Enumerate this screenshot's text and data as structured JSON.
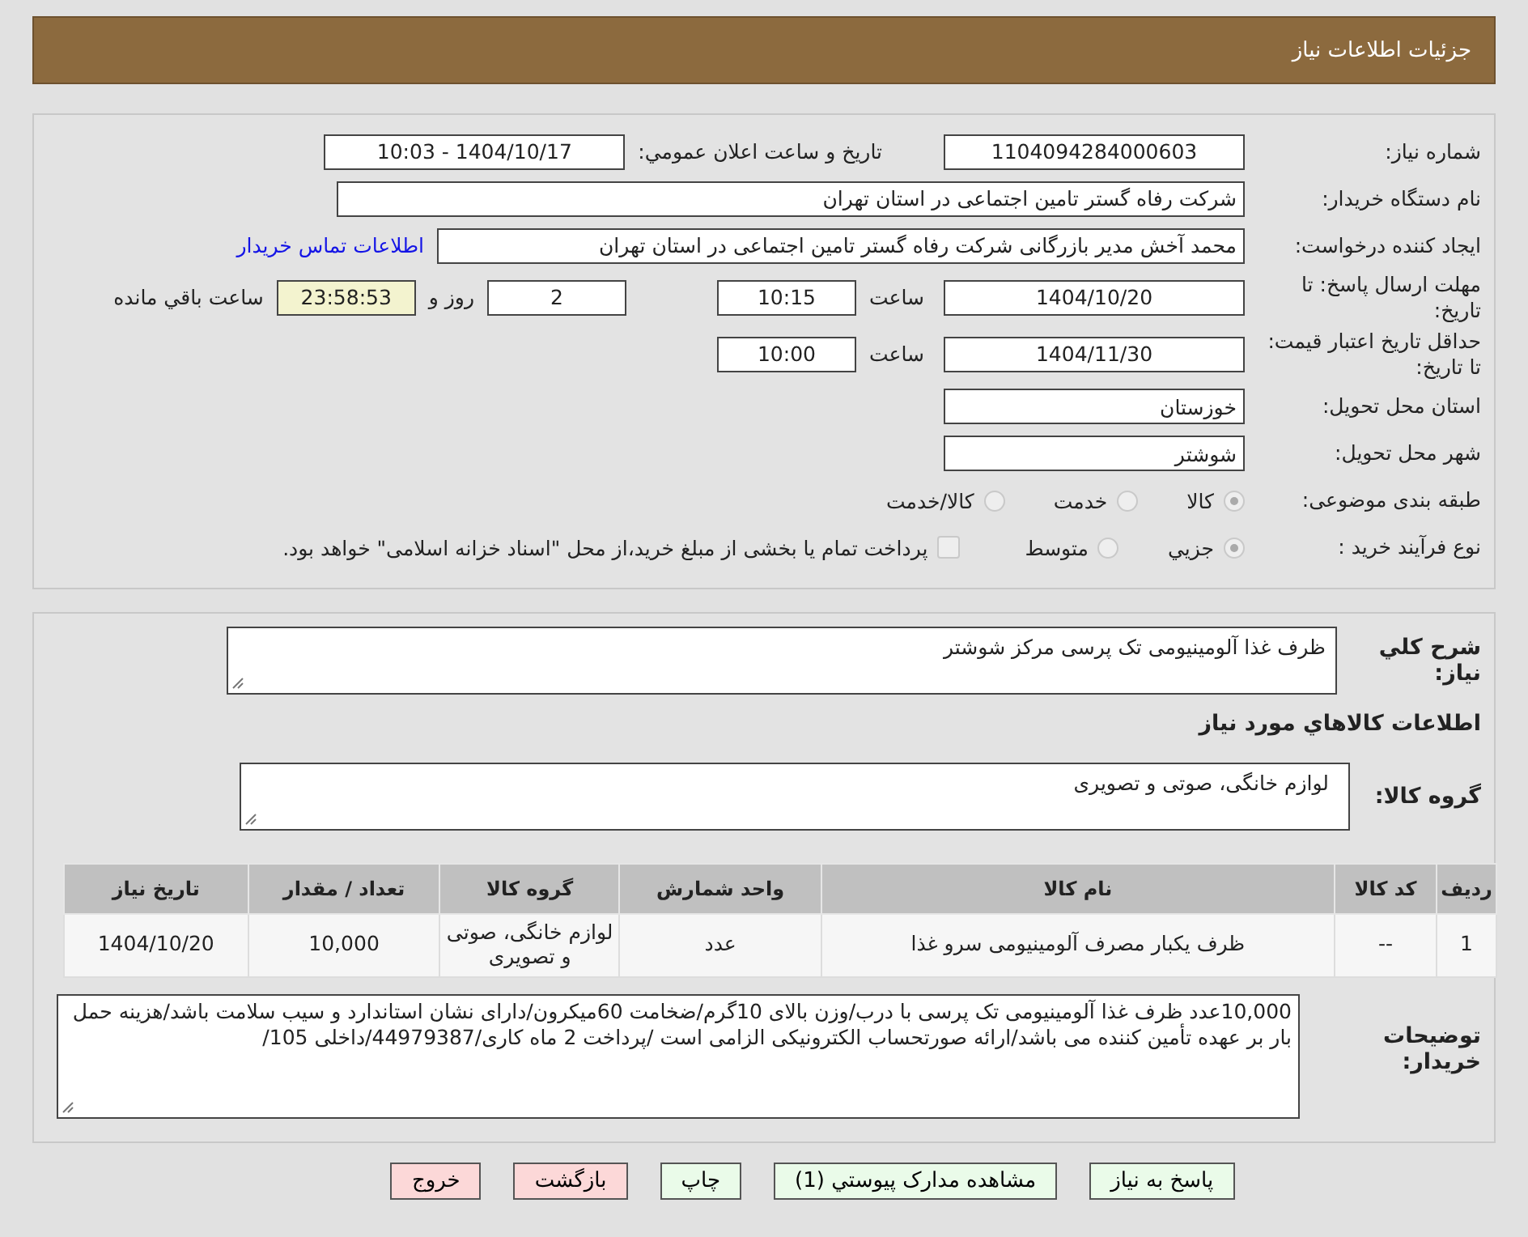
{
  "header": {
    "title": "جزئیات اطلاعات نیاز"
  },
  "need_number": {
    "label": "شماره نیاز:",
    "value": "1104094284000603"
  },
  "announce": {
    "label": "تاریخ و ساعت اعلان عمومي:",
    "value": "1404/10/17 - 10:03"
  },
  "buyer": {
    "label": "نام دستگاه خریدار:",
    "value": "شرکت رفاه گستر تامین اجتماعی در استان تهران"
  },
  "requester": {
    "label": "ایجاد کننده درخواست:",
    "value": "محمد آخش مدیر بازرگانی شرکت رفاه گستر تامین اجتماعی در استان تهران",
    "link": "اطلاعات تماس خریدار"
  },
  "deadline": {
    "label": "مهلت ارسال پاسخ: تا تاریخ:",
    "date": "1404/10/20",
    "time_label": "ساعت",
    "time": "10:15",
    "days": "2",
    "days_label": "روز و",
    "remaining": "23:58:53",
    "remaining_label": "ساعت باقي مانده"
  },
  "validity": {
    "label": "حداقل تاریخ اعتبار قیمت: تا تاریخ:",
    "date": "1404/11/30",
    "time_label": "ساعت",
    "time": "10:00"
  },
  "province": {
    "label": "استان محل تحویل:",
    "value": "خوزستان"
  },
  "city": {
    "label": "شهر محل تحویل:",
    "value": "شوشتر"
  },
  "category": {
    "label": "طبقه بندی موضوعی:",
    "options": [
      {
        "label": "کالا",
        "selected": true
      },
      {
        "label": "خدمت",
        "selected": false
      },
      {
        "label": "کالا/خدمت",
        "selected": false
      }
    ]
  },
  "process": {
    "label": "نوع فرآیند خرید :",
    "options": [
      {
        "label": "جزيي",
        "selected": true
      },
      {
        "label": "متوسط",
        "selected": false
      }
    ],
    "treasury": {
      "checked": false,
      "label": "پرداخت تمام یا بخشی از مبلغ خرید،از محل \"اسناد خزانه اسلامی\" خواهد بود."
    }
  },
  "description": {
    "label": "شرح کلي نیاز:",
    "value": "ظرف غذا آلومینیومی تک پرسی مرکز شوشتر"
  },
  "goods_heading": "اطلاعات کالاهاي مورد نیاز",
  "goods_group": {
    "label": "گروه کالا:",
    "value": "لوازم خانگی، صوتی و تصویری"
  },
  "table": {
    "columns": [
      "ردیف",
      "کد کالا",
      "نام کالا",
      "واحد شمارش",
      "گروه کالا",
      "تعداد / مقدار",
      "تاریخ نیاز"
    ],
    "rows": [
      [
        "1",
        "--",
        "ظرف یکبار مصرف آلومینیومی سرو غذا",
        "عدد",
        "لوازم خانگی، صوتی و تصویری",
        "10,000",
        "1404/10/20"
      ]
    ]
  },
  "notes": {
    "label": "توضیحات خریدار:",
    "value": "10,000عدد ظرف غذا آلومینیومی تک پرسی با درب/وزن بالای 10گرم/ضخامت 60میکرون/دارای نشان استاندارد و سیب سلامت باشد/هزینه حمل بار بر عهده تأمین کننده می باشد/ارائه صورتحساب الکترونیکی الزامی است /پرداخت 2 ماه کاری/44979387/داخلی 105/"
  },
  "buttons": [
    {
      "label": "پاسخ به نیاز",
      "kind": "green"
    },
    {
      "label": "مشاهده مدارک پیوستي (1)",
      "kind": "green"
    },
    {
      "label": "چاپ",
      "kind": "green"
    },
    {
      "label": "بازگشت",
      "kind": "red"
    },
    {
      "label": "خروج",
      "kind": "red"
    }
  ]
}
